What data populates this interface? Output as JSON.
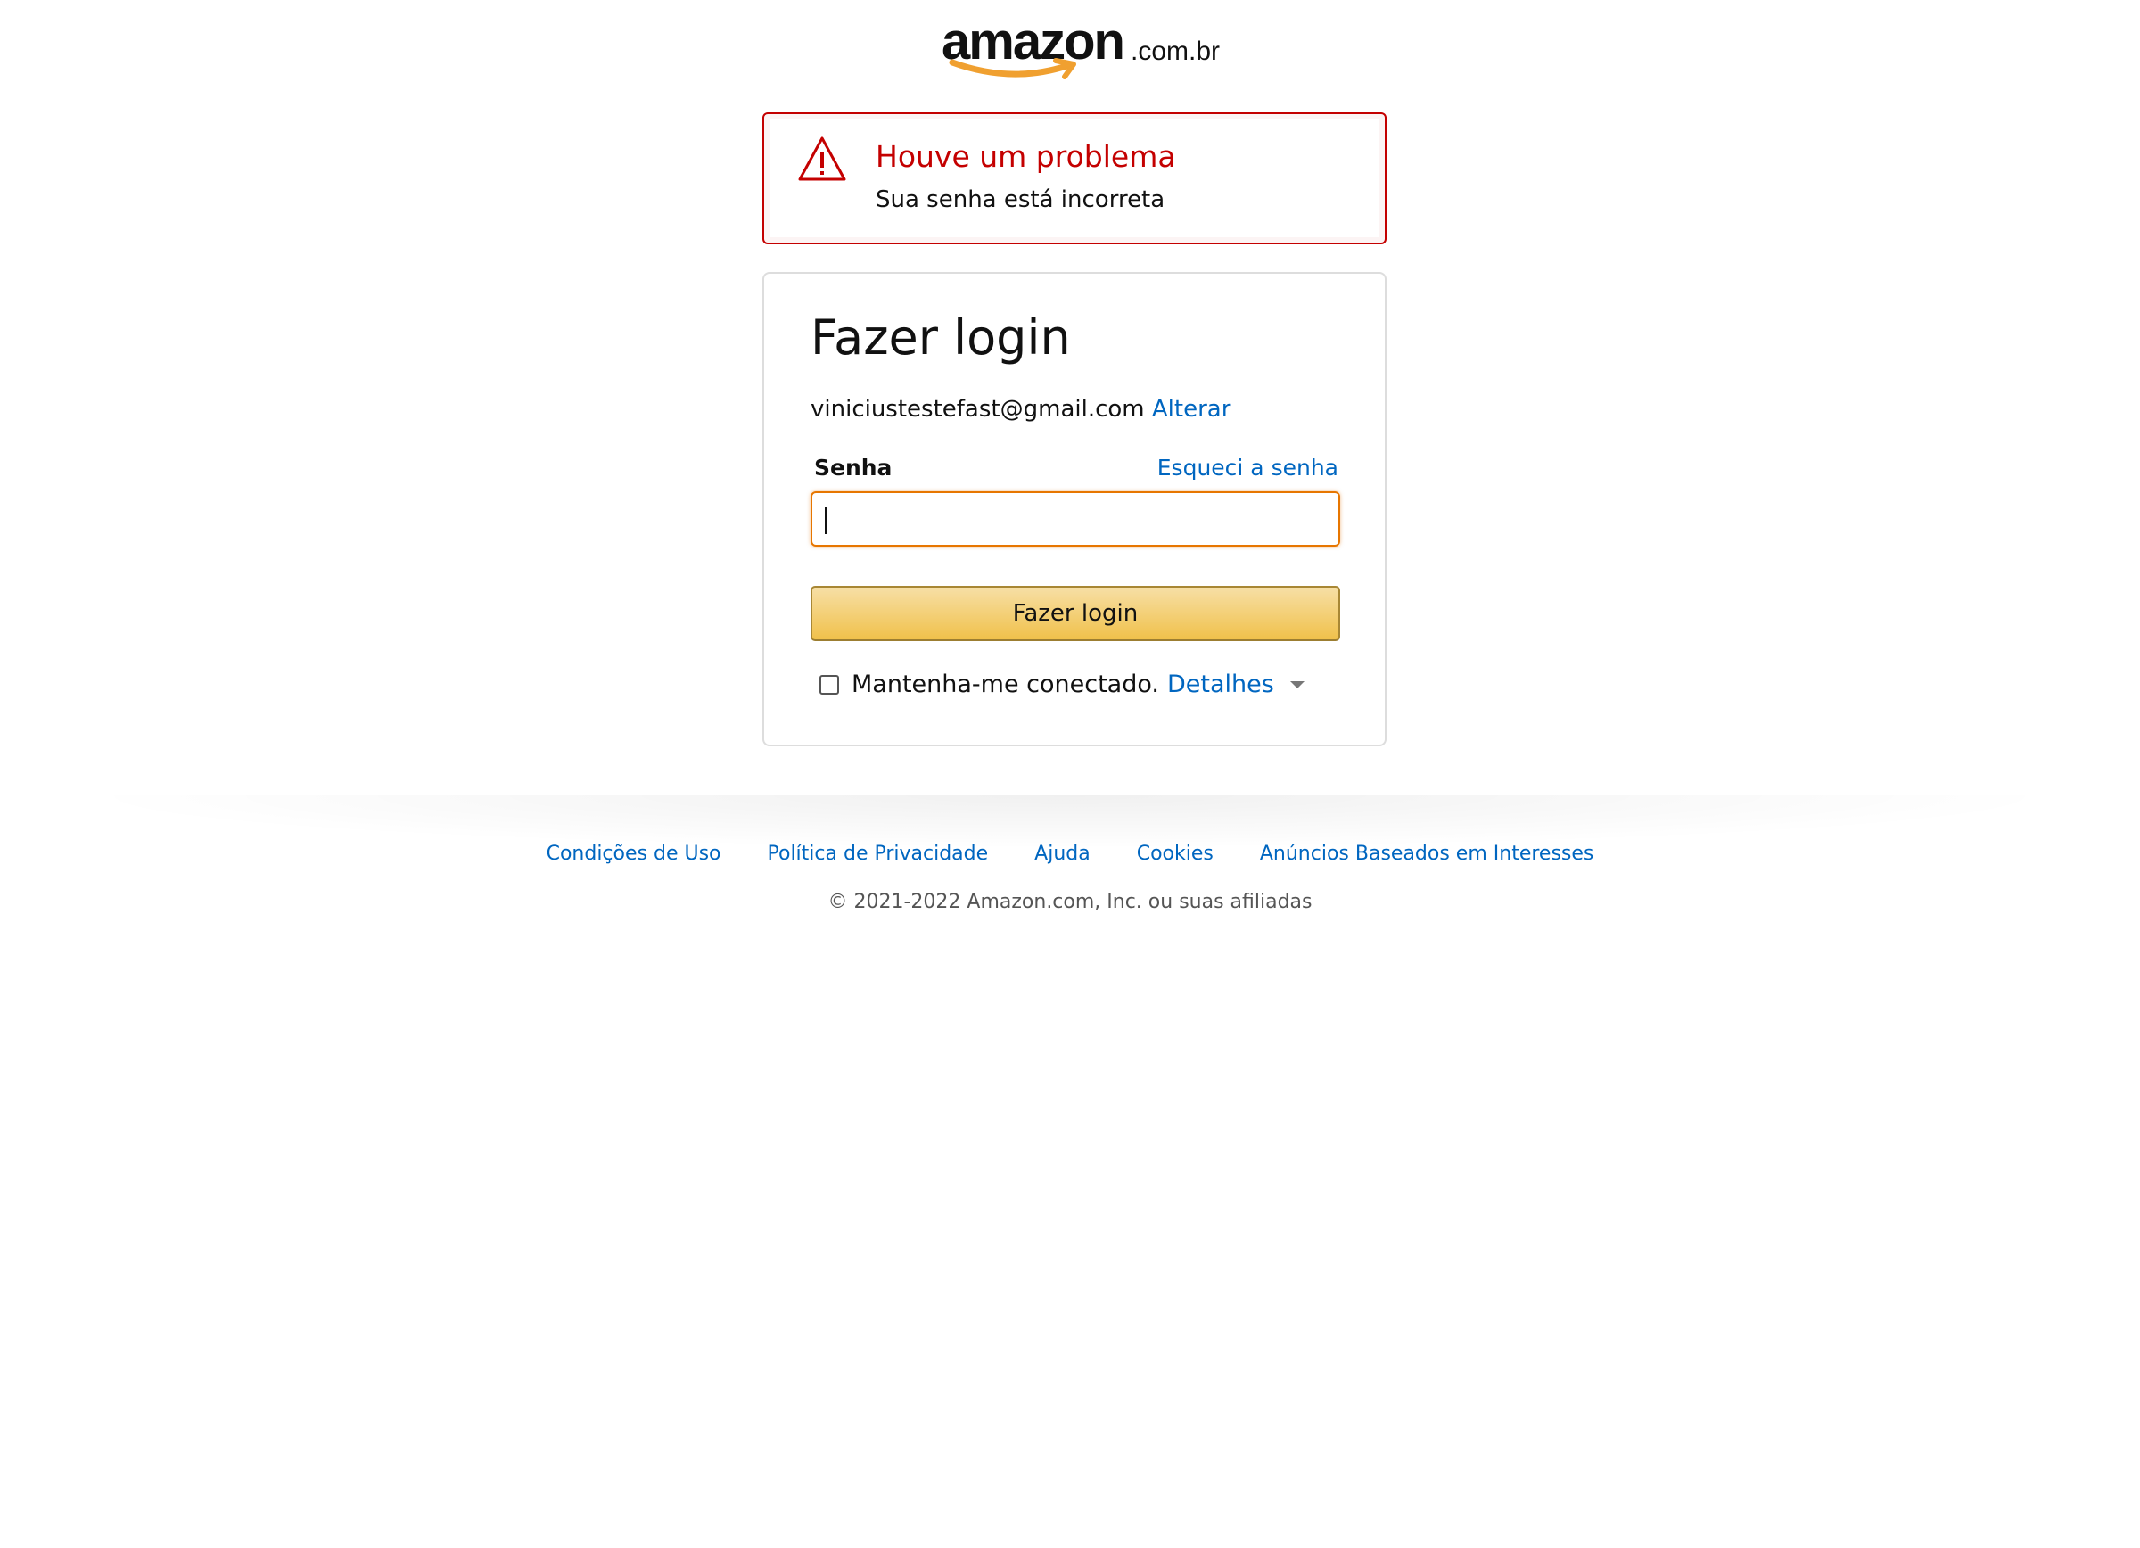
{
  "logo": {
    "wordmark": "amazon",
    "tld": ".com.br"
  },
  "alert": {
    "heading": "Houve um problema",
    "message": "Sua senha está incorreta",
    "icon": "warning-triangle-icon",
    "color": "#c40000"
  },
  "signin": {
    "title": "Fazer login",
    "email": "viniciustestefast@gmail.com",
    "change_link": "Alterar",
    "password_label": "Senha",
    "forgot_link": "Esqueci a senha",
    "password_value": "",
    "submit_label": "Fazer login",
    "remember_label": "Mantenha-me conectado.",
    "details_link": "Detalhes",
    "remember_checked": false
  },
  "footer": {
    "links": [
      "Condições de Uso",
      "Política de Privacidade",
      "Ajuda",
      "Cookies",
      "Anúncios Baseados em Interesses"
    ],
    "copyright": "© 2021-2022 Amazon.com, Inc. ou suas afiliadas"
  },
  "colors": {
    "link": "#0066c0",
    "button_top": "#f7dfa5",
    "button_bottom": "#f0c14b",
    "input_focus": "#e77600",
    "logo_smile": "#f0a030"
  }
}
